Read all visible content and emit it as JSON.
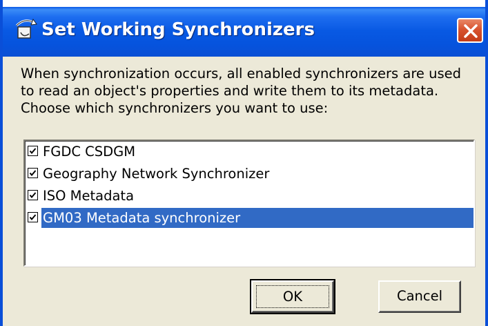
{
  "window": {
    "title": "Set Working Synchronizers",
    "icon": "synchronizer-icon",
    "close_icon": "close-icon",
    "accent": "#0a58e6"
  },
  "description": "When synchronization occurs, all enabled synchronizers are used to read an object's properties and write them to its metadata. Choose which synchronizers you want to use:",
  "synchronizers": [
    {
      "label": "FGDC CSDGM",
      "checked": true,
      "selected": false
    },
    {
      "label": "Geography Network Synchronizer",
      "checked": true,
      "selected": false
    },
    {
      "label": "ISO Metadata",
      "checked": true,
      "selected": false
    },
    {
      "label": "GM03 Metadata synchronizer",
      "checked": true,
      "selected": true
    }
  ],
  "buttons": {
    "ok_label": "OK",
    "cancel_label": "Cancel"
  },
  "colors": {
    "selection": "#316ac5",
    "dialog_bg": "#ece9d8",
    "close_button": "#d8532f"
  }
}
